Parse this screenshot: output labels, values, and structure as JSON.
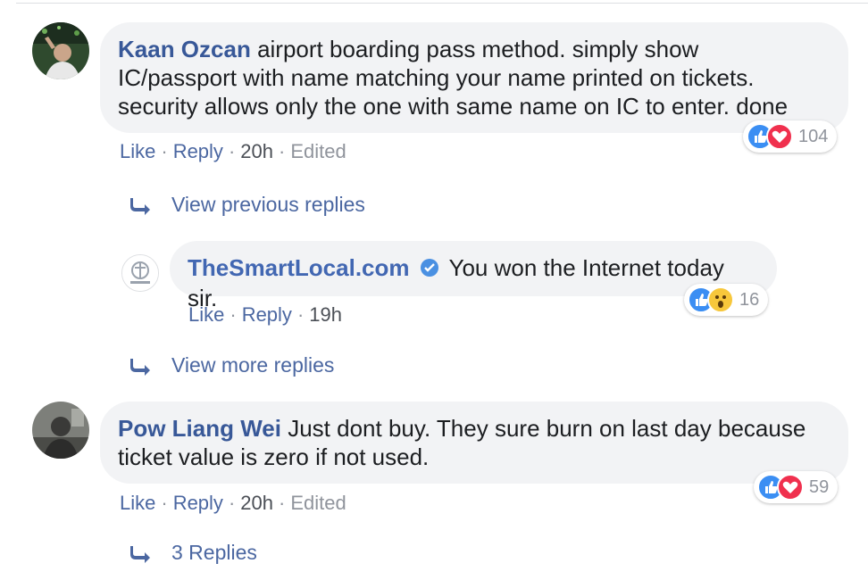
{
  "comments": [
    {
      "author": "Kaan Ozcan",
      "lines": [
        "airport boarding pass method. simply show",
        "IC/passport with name matching your name printed on tickets.",
        "security allows only the one with same name on IC to enter. done"
      ],
      "actions": {
        "like": "Like",
        "reply": "Reply",
        "time": "20h",
        "edited": "Edited"
      },
      "reactions": {
        "types": [
          "like-icon",
          "love-icon"
        ],
        "count": "104"
      }
    },
    {
      "author": "Pow Liang Wei",
      "lines": [
        "Just dont buy. They sure burn on last day because",
        "ticket value is zero if not used."
      ],
      "actions": {
        "like": "Like",
        "reply": "Reply",
        "time": "20h",
        "edited": "Edited"
      },
      "reactions": {
        "types": [
          "like-icon",
          "love-icon"
        ],
        "count": "59"
      }
    }
  ],
  "view_previous_replies": "View previous replies",
  "reply": {
    "author": "TheSmartLocal.com",
    "text": "You won the Internet today sir.",
    "actions": {
      "like": "Like",
      "reply": "Reply",
      "time": "19h"
    },
    "reactions": {
      "types": [
        "like-icon",
        "wow-icon"
      ],
      "count": "16"
    }
  },
  "view_more_replies": "View more replies",
  "replies_count_link": "3 Replies",
  "colors": {
    "bubble": "#f2f3f5",
    "name": "#385898",
    "link": "#4b67a1",
    "meta": "#90949c",
    "like": "#3b8ef3",
    "love": "#f0304e",
    "wow": "#f7c73b",
    "verified": "#4a90e2"
  }
}
